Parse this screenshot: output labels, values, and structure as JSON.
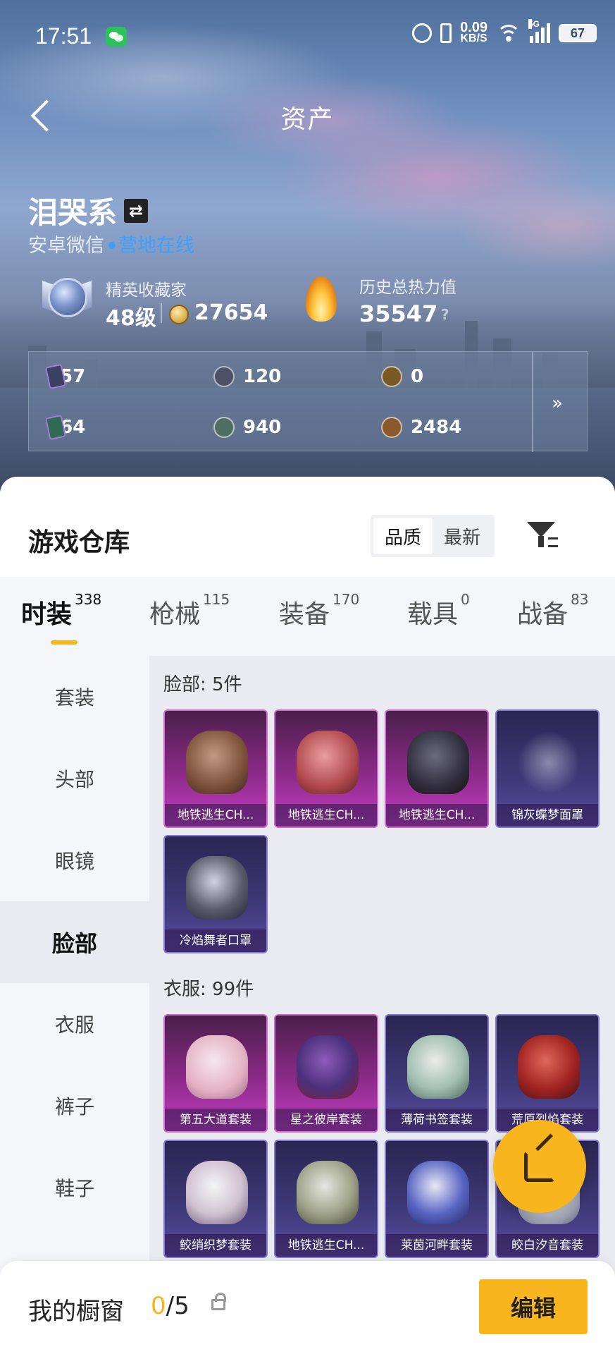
{
  "status_bar": {
    "time": "17:51",
    "net_speed": "0.09",
    "net_unit": "KB/S",
    "network": "5G",
    "battery": "67"
  },
  "header": {
    "title": "资产"
  },
  "profile": {
    "name": "泪哭系",
    "platform": "安卓微信",
    "online_status": "营地在线",
    "rank_label": "精英收藏家",
    "rank_level": "48级",
    "collection_points": "27654",
    "heat_label": "历史总热力值",
    "heat_value": "35547",
    "help": "?"
  },
  "currencies": {
    "items": [
      {
        "icon": "card-icon",
        "value": "657"
      },
      {
        "icon": "silver-coin-icon",
        "value": "120"
      },
      {
        "icon": "gold-token-icon",
        "value": "0"
      },
      {
        "icon": "green-card-icon",
        "value": "364"
      },
      {
        "icon": "jade-coin-icon",
        "value": "940"
      },
      {
        "icon": "bronze-coin-icon",
        "value": "2484"
      }
    ],
    "more": "»"
  },
  "warehouse": {
    "title": "游戏仓库",
    "sort_options": [
      "品质",
      "最新"
    ],
    "sort_selected": "品质"
  },
  "category_tabs": [
    {
      "label": "时装",
      "count": "338",
      "active": true
    },
    {
      "label": "枪械",
      "count": "115"
    },
    {
      "label": "装备",
      "count": "170"
    },
    {
      "label": "载具",
      "count": "0"
    },
    {
      "label": "战备",
      "count": "83"
    }
  ],
  "side_nav": [
    {
      "label": "套装"
    },
    {
      "label": "头部"
    },
    {
      "label": "眼镜"
    },
    {
      "label": "脸部",
      "active": true
    },
    {
      "label": "衣服"
    },
    {
      "label": "裤子"
    },
    {
      "label": "鞋子"
    }
  ],
  "sections": [
    {
      "title": "脸部: 5件",
      "items": [
        {
          "name": "地铁逃生CH...",
          "rarity": "purple"
        },
        {
          "name": "地铁逃生CH...",
          "rarity": "purple"
        },
        {
          "name": "地铁逃生CH...",
          "rarity": "purple"
        },
        {
          "name": "锦灰蝶梦面罩",
          "rarity": "blue"
        },
        {
          "name": "冷焰舞者口罩",
          "rarity": "blue"
        }
      ]
    },
    {
      "title": "衣服: 99件",
      "items": [
        {
          "name": "第五大道套装",
          "rarity": "purple"
        },
        {
          "name": "星之彼岸套装",
          "rarity": "purple"
        },
        {
          "name": "薄荷书签套装",
          "rarity": "blue"
        },
        {
          "name": "荒原烈焰套装",
          "rarity": "blue"
        },
        {
          "name": "鲛绡织梦套装",
          "rarity": "blue"
        },
        {
          "name": "地铁逃生CH...",
          "rarity": "blue"
        },
        {
          "name": "莱茵河畔套装",
          "rarity": "blue"
        },
        {
          "name": "皎白汐音套装",
          "rarity": "blue"
        }
      ]
    }
  ],
  "showcase": {
    "label": "我的橱窗",
    "used": "0",
    "total": "/5",
    "edit_label": "编辑"
  }
}
